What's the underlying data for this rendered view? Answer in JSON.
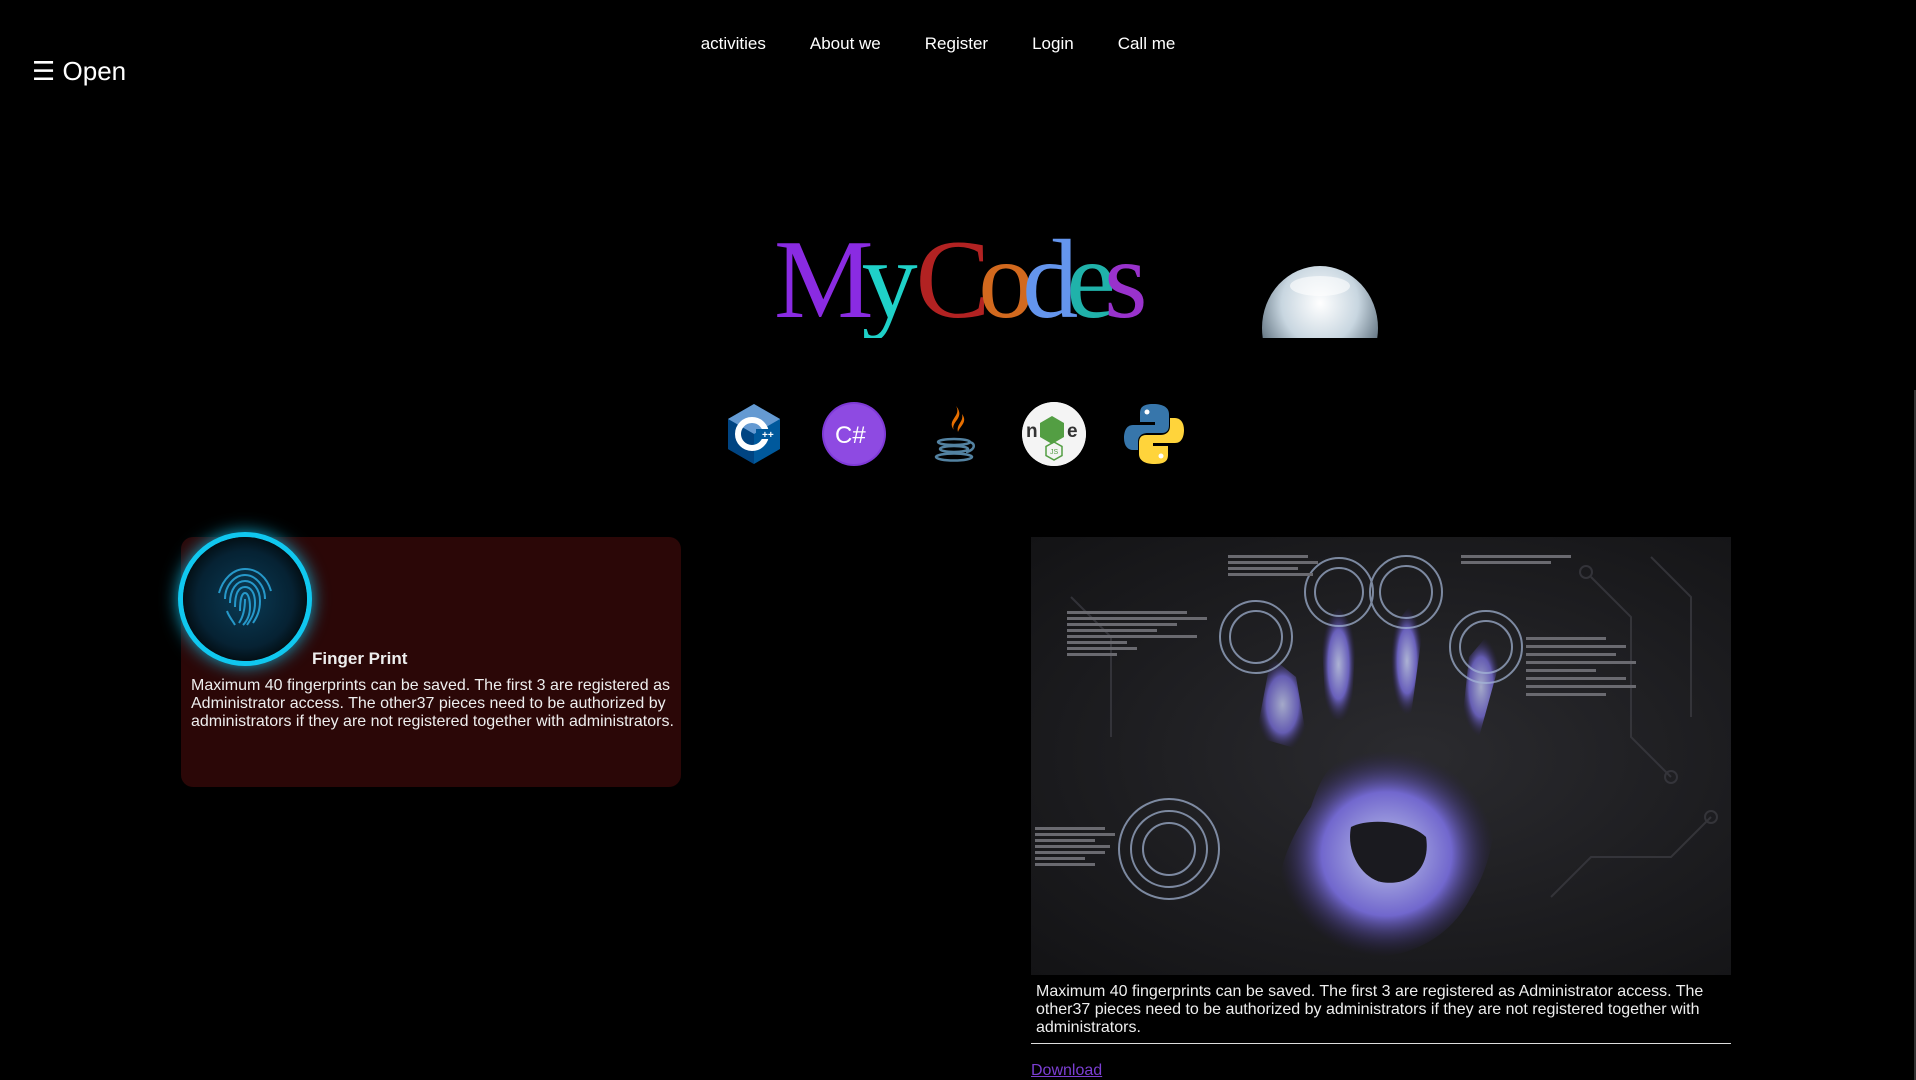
{
  "sidebar_toggle": {
    "icon": "hamburger-icon",
    "label": "☰ Open"
  },
  "nav": {
    "items": [
      {
        "label": "activities"
      },
      {
        "label": "About we"
      },
      {
        "label": "Register"
      },
      {
        "label": "Login"
      },
      {
        "label": "Call me"
      }
    ]
  },
  "hero": {
    "logo_letters": [
      {
        "ch": "M",
        "color": "#8a2be2"
      },
      {
        "ch": "y",
        "color": "#1fd1c8"
      },
      {
        "ch": " ",
        "color": "#000000"
      },
      {
        "ch": "C",
        "color": "#b22222"
      },
      {
        "ch": "o",
        "color": "#d2691e"
      },
      {
        "ch": "d",
        "color": "#6495ed"
      },
      {
        "ch": "e",
        "color": "#20b2aa"
      },
      {
        "ch": "s",
        "color": "#9932cc"
      }
    ],
    "logo_text": "My Codes",
    "image": "robot-head-image"
  },
  "tech_icons": [
    {
      "name": "cpp-icon",
      "label": "C++"
    },
    {
      "name": "csharp-icon",
      "label": "C#"
    },
    {
      "name": "java-icon",
      "label": "Java"
    },
    {
      "name": "nodejs-icon",
      "label": "node JS"
    },
    {
      "name": "python-icon",
      "label": "Python"
    }
  ],
  "card": {
    "title": "Finger Print",
    "text": "Maximum 40 fingerprints can be saved. The first 3 are registered as Administrator access. The other37 pieces need to be authorized by administrators if they are not registered together with administrators.",
    "accent": "#2b0707"
  },
  "panel": {
    "image": "handprint-scan-image",
    "text": "Maximum 40 fingerprints can be saved. The first 3 are registered as Administrator access. The other37 pieces need to be authorized by administrators if they are not registered together with administrators.",
    "link_label": "Download",
    "link_color": "#7c3fd3"
  }
}
